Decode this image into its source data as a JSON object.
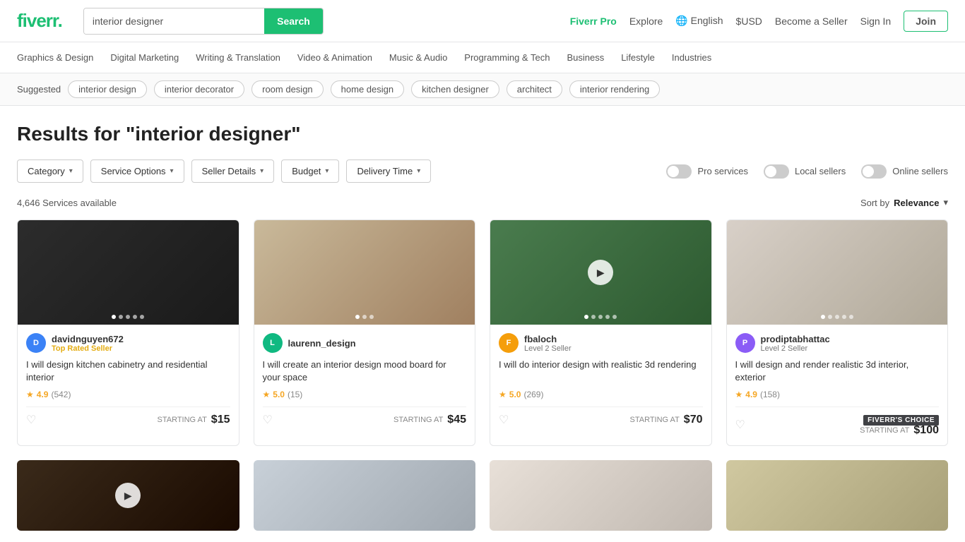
{
  "header": {
    "logo": "fiverr.",
    "search_placeholder": "interior designer",
    "search_button": "Search",
    "nav": {
      "fiverr_pro": "Fiverr Pro",
      "explore": "Explore",
      "language": "English",
      "currency": "$USD",
      "become_seller": "Become a Seller",
      "sign_in": "Sign In",
      "join": "Join"
    }
  },
  "categories": [
    "Graphics & Design",
    "Digital Marketing",
    "Writing & Translation",
    "Video & Animation",
    "Music & Audio",
    "Programming & Tech",
    "Business",
    "Lifestyle",
    "Industries"
  ],
  "suggested": {
    "label": "Suggested",
    "tags": [
      "interior design",
      "interior decorator",
      "room design",
      "home design",
      "kitchen designer",
      "architect",
      "interior rendering"
    ]
  },
  "results": {
    "heading": "Results for \"interior designer\"",
    "count": "4,646 Services available",
    "sort_label": "Sort by",
    "sort_value": "Relevance"
  },
  "filters": [
    {
      "label": "Category",
      "id": "category-filter"
    },
    {
      "label": "Service Options",
      "id": "service-options-filter"
    },
    {
      "label": "Seller Details",
      "id": "seller-details-filter"
    },
    {
      "label": "Budget",
      "id": "budget-filter"
    },
    {
      "label": "Delivery Time",
      "id": "delivery-time-filter"
    }
  ],
  "toggles": [
    {
      "label": "Pro services",
      "active": false,
      "id": "pro-services-toggle"
    },
    {
      "label": "Local sellers",
      "active": false,
      "id": "local-sellers-toggle"
    },
    {
      "label": "Online sellers",
      "active": false,
      "id": "online-sellers-toggle"
    }
  ],
  "cards": [
    {
      "id": "card-1",
      "seller_name": "davidnguyen672",
      "seller_badge": "Top Rated Seller",
      "seller_badge_type": "top",
      "avatar_initials": "D",
      "avatar_color": "av-blue",
      "title": "I will design kitchen cabinetry and residential interior",
      "rating": "4.9",
      "rating_count": "542",
      "starting_at": "STARTING AT",
      "price": "$15",
      "fiverrs_choice": false,
      "image_class": "img-dark",
      "dots": 5,
      "active_dot": 0,
      "has_play": false
    },
    {
      "id": "card-2",
      "seller_name": "laurenn_design",
      "seller_badge": "",
      "seller_level": "",
      "avatar_initials": "L",
      "avatar_color": "av-green",
      "title": "I will create an interior design mood board for your space",
      "rating": "5.0",
      "rating_count": "15",
      "starting_at": "STARTING AT",
      "price": "$45",
      "fiverrs_choice": false,
      "image_class": "img-mood",
      "dots": 3,
      "active_dot": 0,
      "has_play": false
    },
    {
      "id": "card-3",
      "seller_name": "fbaloch",
      "seller_badge": "",
      "seller_level": "Level 2 Seller",
      "avatar_initials": "F",
      "avatar_color": "av-orange",
      "title": "I will do interior design with realistic 3d rendering",
      "rating": "5.0",
      "rating_count": "269",
      "starting_at": "STARTING AT",
      "price": "$70",
      "fiverrs_choice": false,
      "image_class": "img-green",
      "dots": 5,
      "active_dot": 0,
      "has_play": true
    },
    {
      "id": "card-4",
      "seller_name": "prodiptabhattac",
      "seller_badge": "",
      "seller_level": "Level 2 Seller",
      "avatar_initials": "P",
      "avatar_color": "av-purple",
      "title": "I will design and render realistic 3d interior, exterior",
      "rating": "4.9",
      "rating_count": "158",
      "starting_at": "STARTING AT",
      "price": "$100",
      "fiverrs_choice": true,
      "fiverrs_choice_label": "FIVERR'S CHOICE",
      "image_class": "img-light",
      "dots": 5,
      "active_dot": 0,
      "has_play": false
    }
  ],
  "bottom_cards": [
    {
      "id": "bottom-1",
      "image_class": "img-bottom1",
      "has_play": true
    },
    {
      "id": "bottom-2",
      "image_class": "img-bottom2",
      "has_play": false
    },
    {
      "id": "bottom-3",
      "image_class": "img-bottom3",
      "has_play": false
    },
    {
      "id": "bottom-4",
      "image_class": "img-bottom4",
      "has_play": false
    }
  ]
}
